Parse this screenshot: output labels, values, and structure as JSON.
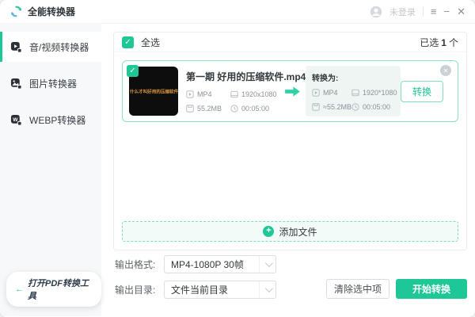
{
  "window": {
    "title": "全能转换器",
    "user": "未登录",
    "menu_icon": "≡",
    "minimize_icon": "−",
    "close_icon": "✕"
  },
  "sidebar": {
    "items": [
      {
        "label": "音/视频转换器",
        "icon": "video-play-icon",
        "active": true
      },
      {
        "label": "图片转换器",
        "icon": "image-icon",
        "active": false
      },
      {
        "label": "WEBP转换器",
        "icon": "webp-icon",
        "active": false
      }
    ],
    "pdf_tool_arrow": "←",
    "pdf_tool_label": "打开PDF转换工具"
  },
  "list_header": {
    "select_all_label": "全选",
    "check_icon": "✓",
    "selected_prefix": "已选",
    "selected_count": "1",
    "selected_suffix": "个"
  },
  "file_card": {
    "thumbnail_text": "什么才叫好用的压缩软件",
    "filename": "第一期 好用的压缩软件.mp4",
    "source": {
      "format": "MP4",
      "resolution": "1920x1080",
      "size": "55.2MB",
      "duration": "00:05:00"
    },
    "target_label": "转换为:",
    "target": {
      "format": "MP4",
      "resolution": "1920*1080",
      "size": "≈55.2MB",
      "duration": "00:05:00"
    },
    "convert_button_label": "转换",
    "close_icon": "✕"
  },
  "add_file": {
    "plus_icon": "+",
    "label": "添加文件"
  },
  "output_settings": {
    "format_label": "输出格式:",
    "format_value": "MP4-1080P 30帧",
    "directory_label": "输出目录:",
    "directory_value": "文件当前目录"
  },
  "actions": {
    "clear_label": "清除选中项",
    "start_label": "开始转换"
  },
  "colors": {
    "accent": "#1dc796",
    "card_border": "#8ce0c9",
    "thumbnail_text_color": "#d8963f",
    "add_zone_bg": "#f3fbf8",
    "sidebar_bg": "#f7f8fa"
  }
}
